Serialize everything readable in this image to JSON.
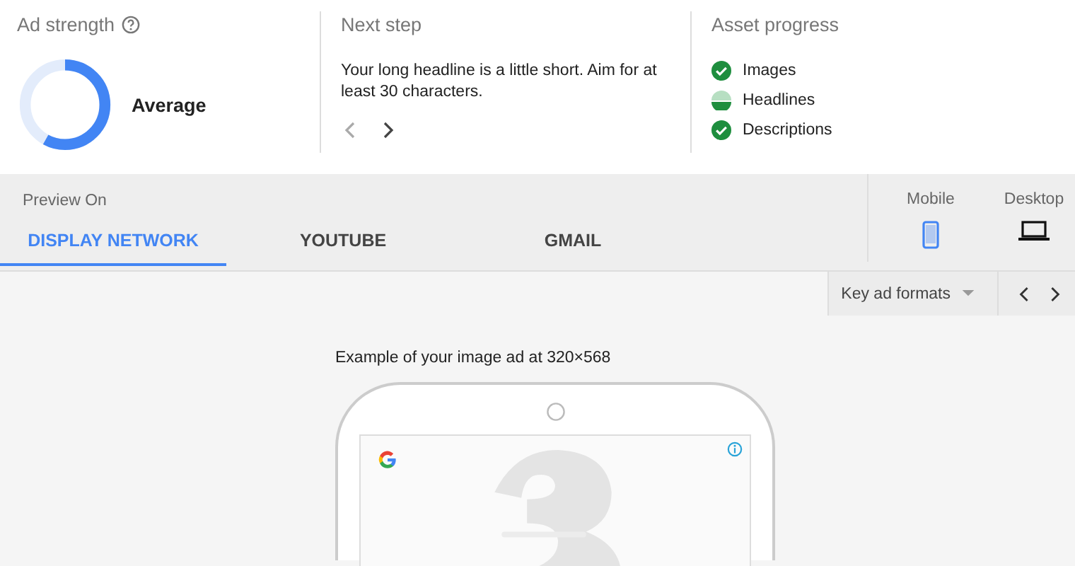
{
  "ad_strength": {
    "title": "Ad strength",
    "level": 0.58,
    "rating": "Average"
  },
  "next_step": {
    "title": "Next step",
    "message": "Your long headline is a little short. Aim for at least 30 characters."
  },
  "asset_progress": {
    "title": "Asset progress",
    "items": [
      {
        "label": "Images",
        "kind": "complete"
      },
      {
        "label": "Headlines",
        "kind": "partial"
      },
      {
        "label": "Descriptions",
        "kind": "complete"
      }
    ]
  },
  "preview": {
    "label": "Preview On",
    "tabs": [
      {
        "label": "DISPLAY NETWORK",
        "selected": true
      },
      {
        "label": "YOUTUBE",
        "selected": false
      },
      {
        "label": "GMAIL",
        "selected": false
      }
    ],
    "devices": [
      {
        "label": "Mobile",
        "kind": "mobile",
        "selected": true
      },
      {
        "label": "Desktop",
        "kind": "desktop",
        "selected": false
      }
    ]
  },
  "format_dropdown": {
    "value": "Key ad formats"
  },
  "example": {
    "caption": "Example of your image ad at 320×568"
  }
}
